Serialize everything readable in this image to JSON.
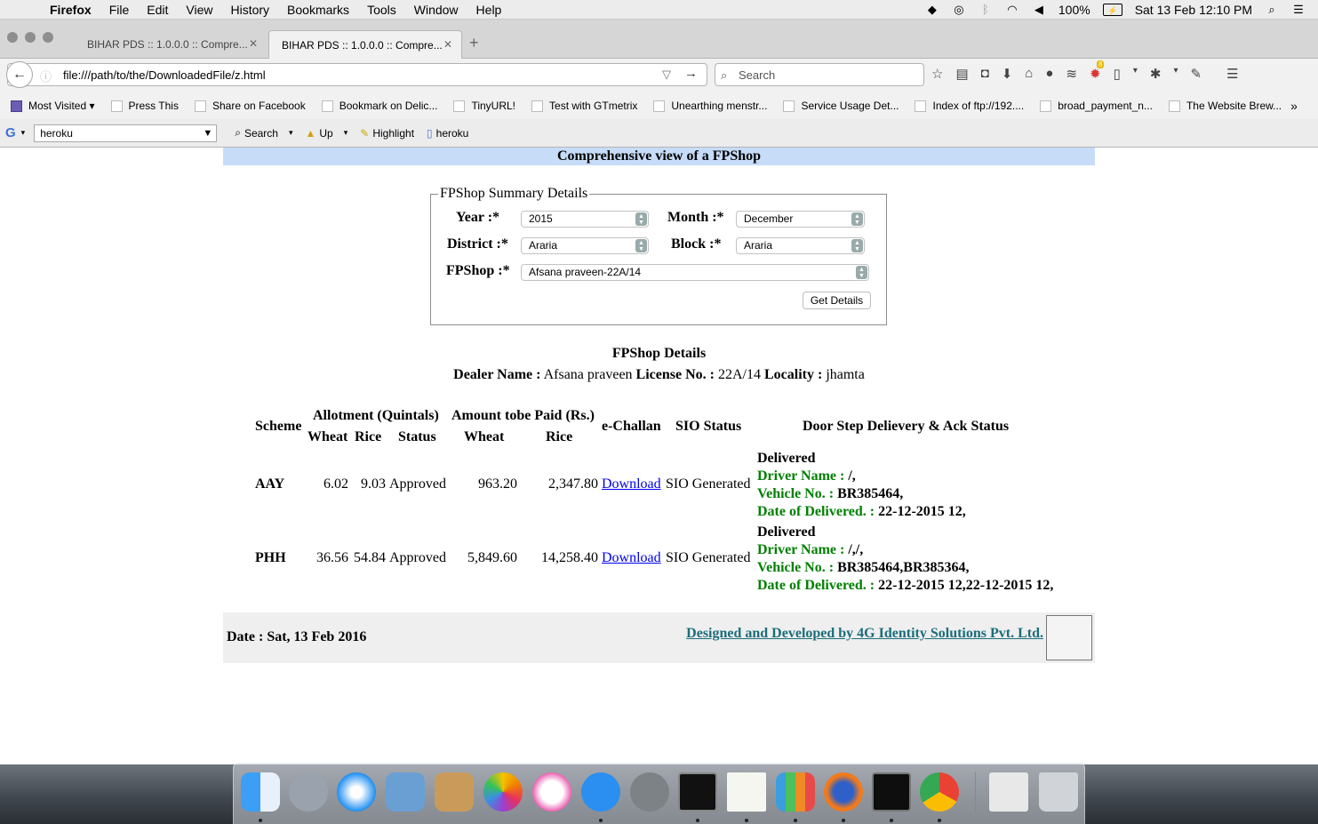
{
  "menubar": {
    "app": "Firefox",
    "items": [
      "File",
      "Edit",
      "View",
      "History",
      "Bookmarks",
      "Tools",
      "Window",
      "Help"
    ],
    "battery": "100%",
    "clock": "Sat 13 Feb  12:10 PM"
  },
  "tabs": [
    {
      "title": "BIHAR PDS :: 1.0.0.0 :: Compre...",
      "active": false
    },
    {
      "title": "BIHAR PDS :: 1.0.0.0 :: Compre...",
      "active": true
    }
  ],
  "nav": {
    "url": "file:///path/to/the/DownloadedFile/z.html",
    "search_placeholder": "Search",
    "badge_count": "8"
  },
  "bookmarks": [
    "Most Visited",
    "Press This",
    "Share on Facebook",
    "Bookmark on Delic...",
    "TinyURL!",
    "Test with GTmetrix",
    "Unearthing menstr...",
    "Service Usage Det...",
    "Index of ftp://192....",
    "broad_payment_n...",
    "The Website Brew..."
  ],
  "gtoolbar": {
    "query": "heroku",
    "search_label": "Search",
    "up_label": "Up",
    "highlight_label": "Highlight",
    "heroku_label": "heroku"
  },
  "page": {
    "header": "Comprehensive view of a FPShop",
    "summary_legend": "FPShop Summary Details",
    "labels": {
      "year": "Year :*",
      "month": "Month :*",
      "district": "District :*",
      "block": "Block :*",
      "fpshop": "FPShop :*"
    },
    "values": {
      "year": "2015",
      "month": "December",
      "district": "Araria",
      "block": "Araria",
      "fpshop": "Afsana praveen-22A/14"
    },
    "get_details": "Get Details",
    "details_title": "FPShop Details",
    "dealer_label": "Dealer Name :",
    "dealer_name": "Afsana praveen",
    "license_label": "License No. :",
    "license_no": "22A/14",
    "locality_label": "Locality :",
    "locality": "jhamta",
    "table": {
      "headers": {
        "scheme": "Scheme",
        "allotment": "Allotment (Quintals)",
        "amount": "Amount tobe Paid (Rs.)",
        "wheat": "Wheat",
        "rice": "Rice",
        "status": "Status",
        "echallan": "e-Challan",
        "sio": "SIO Status",
        "door": "Door Step Delievery & Ack Status"
      },
      "labels": {
        "driver": "Driver Name :",
        "vehicle": "Vehicle No. :",
        "date": "Date of Delivered. :"
      },
      "rows": [
        {
          "scheme": "AAY",
          "wheat": "6.02",
          "rice": "9.03",
          "status": "Approved",
          "amt_wheat": "963.20",
          "amt_rice": "2,347.80",
          "challan": "Download",
          "sio": "SIO Generated",
          "delivery_status": "Delivered",
          "driver": "/,",
          "vehicle": "BR385464,",
          "date": "22-12-2015 12,"
        },
        {
          "scheme": "PHH",
          "wheat": "36.56",
          "rice": "54.84",
          "status": "Approved",
          "amt_wheat": "5,849.60",
          "amt_rice": "14,258.40",
          "challan": "Download",
          "sio": "SIO Generated",
          "delivery_status": "Delivered",
          "driver": "/,/,",
          "vehicle": "BR385464,BR385364,",
          "date": "22-12-2015 12,22-12-2015 12,"
        }
      ]
    },
    "footer_date": "Date : Sat, 13 Feb 2016",
    "footer_credit": "Designed and Developed by 4G Identity Solutions Pvt. Ltd."
  },
  "dock": {
    "apps": [
      "finder",
      "launchpad",
      "safari",
      "mail",
      "contacts",
      "photos",
      "itunes",
      "app-store",
      "system-preferences",
      "terminal",
      "textedit",
      "numbers",
      "firefox",
      "activity-monitor",
      "chrome",
      "downloads",
      "trash"
    ]
  }
}
